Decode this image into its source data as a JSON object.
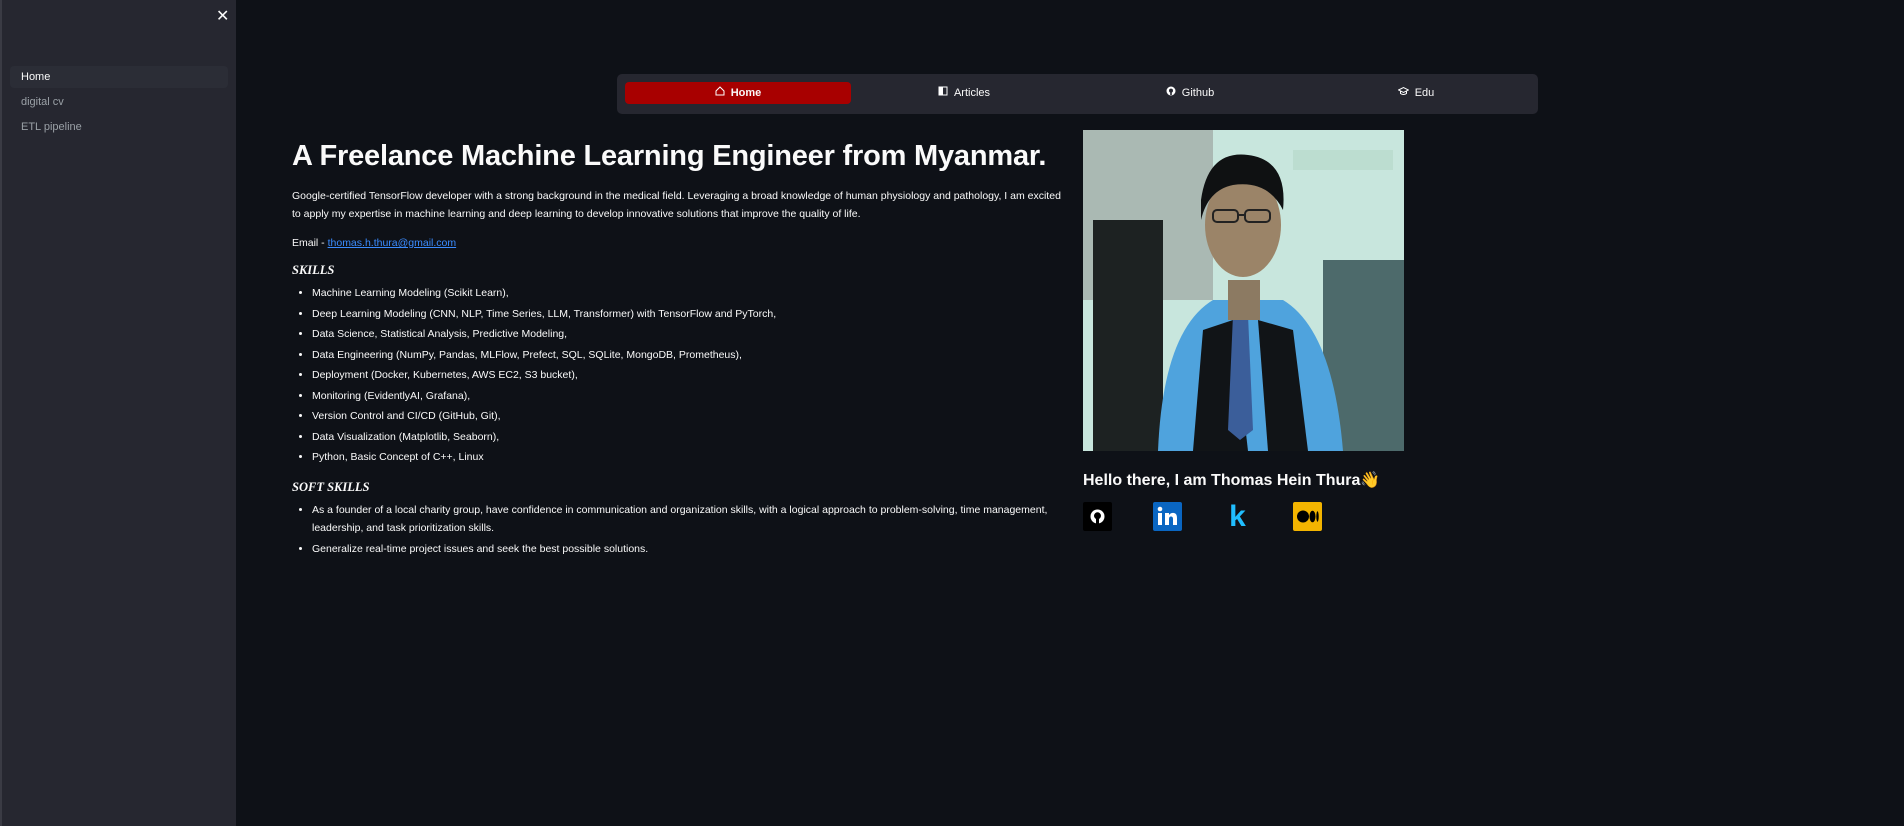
{
  "sidebar": {
    "close_icon": "close-icon",
    "items": [
      {
        "label": "Home",
        "active": true
      },
      {
        "label": "digital cv",
        "active": false
      },
      {
        "label": "ETL pipeline",
        "active": false
      }
    ]
  },
  "topnav": {
    "tabs": [
      {
        "label": "Home",
        "icon": "house-icon",
        "active": true
      },
      {
        "label": "Articles",
        "icon": "book-icon",
        "active": false
      },
      {
        "label": "Github",
        "icon": "github-icon",
        "active": false
      },
      {
        "label": "Edu",
        "icon": "mortarboard-icon",
        "active": false
      }
    ],
    "active_color": "#a80000"
  },
  "main": {
    "title": "A Freelance Machine Learning Engineer from Myanmar.",
    "intro": "Google-certified TensorFlow developer with a strong background in the medical field. Leveraging a broad knowledge of human physiology and pathology, I am excited to apply my expertise in machine learning and deep learning to develop innovative solutions that improve the quality of life.",
    "email_prefix": "Email - ",
    "email": "thomas.h.thura@gmail.com",
    "skills_title": "SKILLS",
    "skills": [
      "Machine Learning Modeling (Scikit Learn),",
      "Deep Learning Modeling (CNN, NLP, Time Series, LLM, Transformer) with TensorFlow and PyTorch,",
      "Data Science, Statistical Analysis, Predictive Modeling,",
      "Data Engineering (NumPy, Pandas, MLFlow, Prefect, SQL, SQLite, MongoDB, Prometheus),",
      "Deployment (Docker, Kubernetes, AWS EC2, S3 bucket),",
      "Monitoring (EvidentlyAI, Grafana),",
      "Version Control and CI/CD (GitHub, Git),",
      "Data Visualization (Matplotlib, Seaborn),",
      "Python, Basic Concept of C++, Linux"
    ],
    "soft_skills_title": "SOFT SKILLS",
    "soft_skills": [
      "As a founder of a local charity group, have confidence in communication and organization skills, with a logical approach to problem-solving, time management, leadership, and task prioritization skills.",
      "Generalize real-time project issues and seek the best possible solutions."
    ]
  },
  "profile": {
    "greeting": "Hello there, I am Thomas Hein Thura👋",
    "social": [
      {
        "name": "github-icon",
        "color": "#000000"
      },
      {
        "name": "linkedin-icon",
        "color": "#0a66c2"
      },
      {
        "name": "kaggle-icon",
        "color": "#20beff"
      },
      {
        "name": "medium-icon",
        "color": "#f3b400"
      }
    ]
  },
  "colors": {
    "background": "#0e1117",
    "sidebar": "#262730",
    "link": "#3b8cff"
  }
}
